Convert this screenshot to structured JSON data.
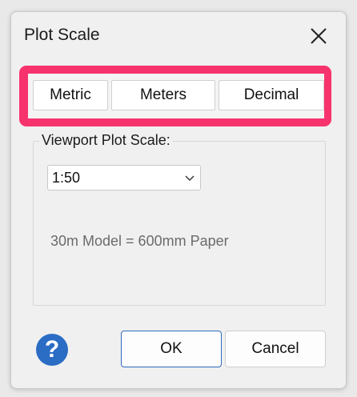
{
  "dialog": {
    "title": "Plot Scale",
    "close_icon": "close-icon"
  },
  "highlight_color": "#f7336e",
  "segments": [
    {
      "label": "Metric"
    },
    {
      "label": "Meters"
    },
    {
      "label": "Decimal"
    }
  ],
  "viewport": {
    "group_label": "Viewport Plot Scale:",
    "scale_selected": "1:50",
    "chevron_icon": "chevron-down-icon",
    "scale_info": "30m Model = 600mm Paper"
  },
  "footer": {
    "help_icon": "help-icon",
    "help_glyph": "?",
    "ok_label": "OK",
    "cancel_label": "Cancel"
  }
}
